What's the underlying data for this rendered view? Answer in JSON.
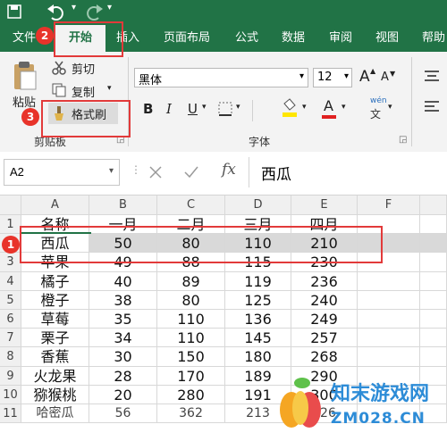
{
  "ribbon": {
    "tabs": [
      {
        "label": "文件"
      },
      {
        "label": "开始"
      },
      {
        "label": "插入"
      },
      {
        "label": "页面布局"
      },
      {
        "label": "公式"
      },
      {
        "label": "数据"
      },
      {
        "label": "审阅"
      },
      {
        "label": "视图"
      },
      {
        "label": "帮助"
      }
    ],
    "clipboard": {
      "paste_label": "粘贴",
      "cut_label": "剪切",
      "copy_label": "复制",
      "format_painter_label": "格式刷",
      "group_label": "剪贴板"
    },
    "font": {
      "font_name": "黑体",
      "font_size": "12",
      "bold": "B",
      "italic": "I",
      "underline": "U",
      "grow_font": "A",
      "shrink_font": "A",
      "font_color_letter": "A",
      "phonetic": "wén",
      "group_label": "字体"
    }
  },
  "formula_bar": {
    "name_box": "A2",
    "fx": "fx",
    "content": "西瓜"
  },
  "sheet": {
    "col_headers": [
      "A",
      "B",
      "C",
      "D",
      "E",
      "F"
    ],
    "rows": [
      {
        "num": "1",
        "cells": [
          "名称",
          "一月",
          "二月",
          "三月",
          "四月",
          ""
        ]
      },
      {
        "num": "2",
        "cells": [
          "西瓜",
          "50",
          "80",
          "110",
          "210",
          ""
        ]
      },
      {
        "num": "3",
        "cells": [
          "苹果",
          "49",
          "88",
          "115",
          "230",
          ""
        ]
      },
      {
        "num": "4",
        "cells": [
          "橘子",
          "40",
          "89",
          "119",
          "236",
          ""
        ]
      },
      {
        "num": "5",
        "cells": [
          "橙子",
          "38",
          "80",
          "125",
          "240",
          ""
        ]
      },
      {
        "num": "6",
        "cells": [
          "草莓",
          "35",
          "110",
          "136",
          "249",
          ""
        ]
      },
      {
        "num": "7",
        "cells": [
          "栗子",
          "34",
          "110",
          "145",
          "257",
          ""
        ]
      },
      {
        "num": "8",
        "cells": [
          "香蕉",
          "30",
          "150",
          "180",
          "268",
          ""
        ]
      },
      {
        "num": "9",
        "cells": [
          "火龙果",
          "28",
          "170",
          "189",
          "290",
          ""
        ]
      },
      {
        "num": "10",
        "cells": [
          "猕猴桃",
          "20",
          "280",
          "191",
          "300",
          ""
        ]
      },
      {
        "num": "11",
        "cells": [
          "哈密瓜",
          "56",
          "362",
          "213",
          "326",
          ""
        ]
      }
    ]
  },
  "annotations": [
    "1",
    "2",
    "3"
  ],
  "watermark": {
    "text": "知末游戏网",
    "url": "ZM028.CN"
  },
  "colors": {
    "excel_green": "#217346",
    "annotation_red": "#e8332a",
    "selection_gray": "#d9d9d9"
  }
}
